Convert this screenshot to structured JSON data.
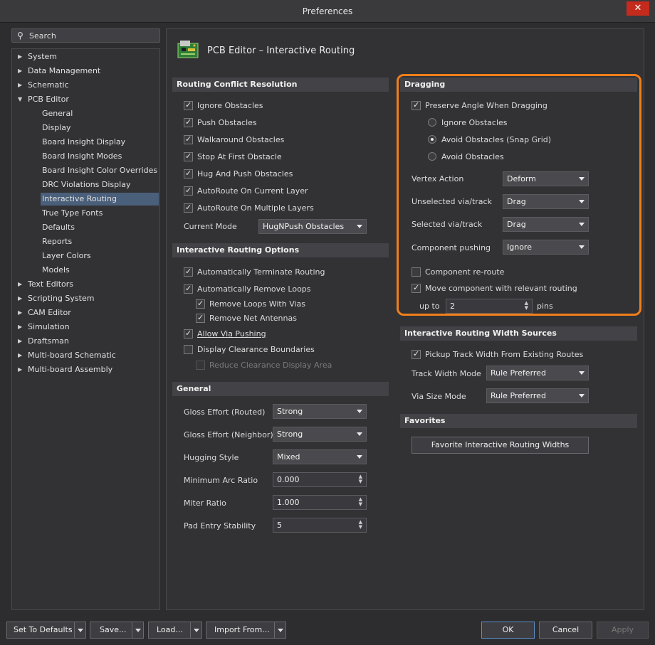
{
  "window": {
    "title": "Preferences",
    "close": "✕"
  },
  "search": {
    "placeholder": "Search"
  },
  "tree": [
    {
      "label": "System",
      "level": 0,
      "expandable": true
    },
    {
      "label": "Data Management",
      "level": 0,
      "expandable": true
    },
    {
      "label": "Schematic",
      "level": 0,
      "expandable": true
    },
    {
      "label": "PCB Editor",
      "level": 0,
      "expanded": true
    },
    {
      "label": "General",
      "level": 1
    },
    {
      "label": "Display",
      "level": 1
    },
    {
      "label": "Board Insight Display",
      "level": 1
    },
    {
      "label": "Board Insight Modes",
      "level": 1
    },
    {
      "label": "Board Insight Color Overrides",
      "level": 1
    },
    {
      "label": "DRC Violations Display",
      "level": 1
    },
    {
      "label": "Interactive Routing",
      "level": 1,
      "selected": true
    },
    {
      "label": "True Type Fonts",
      "level": 1
    },
    {
      "label": "Defaults",
      "level": 1
    },
    {
      "label": "Reports",
      "level": 1
    },
    {
      "label": "Layer Colors",
      "level": 1
    },
    {
      "label": "Models",
      "level": 1
    },
    {
      "label": "Text Editors",
      "level": 0,
      "expandable": true
    },
    {
      "label": "Scripting System",
      "level": 0,
      "expandable": true
    },
    {
      "label": "CAM Editor",
      "level": 0,
      "expandable": true
    },
    {
      "label": "Simulation",
      "level": 0,
      "expandable": true
    },
    {
      "label": "Draftsman",
      "level": 0,
      "expandable": true
    },
    {
      "label": "Multi-board Schematic",
      "level": 0,
      "expandable": true
    },
    {
      "label": "Multi-board Assembly",
      "level": 0,
      "expandable": true
    }
  ],
  "page": {
    "title": "PCB Editor – Interactive Routing"
  },
  "conflict": {
    "title": "Routing Conflict Resolution",
    "options": [
      {
        "label": "Ignore Obstacles",
        "checked": true
      },
      {
        "label": "Push Obstacles",
        "checked": true
      },
      {
        "label": "Walkaround Obstacles",
        "checked": true
      },
      {
        "label": "Stop At First Obstacle",
        "checked": true
      },
      {
        "label": "Hug And Push Obstacles",
        "checked": true
      },
      {
        "label": "AutoRoute On Current Layer",
        "checked": true
      },
      {
        "label": "AutoRoute On Multiple Layers",
        "checked": true
      }
    ],
    "mode_label": "Current Mode",
    "mode_value": "HugNPush Obstacles"
  },
  "iro": {
    "title": "Interactive Routing Options",
    "auto_terminate": "Automatically Terminate Routing",
    "auto_remove_loops": "Automatically Remove Loops",
    "remove_loops_vias": "Remove Loops With Vias",
    "remove_net_antennas": "Remove Net Antennas",
    "allow_via_pushing": "Allow Via Pushing",
    "display_clearance": "Display Clearance Boundaries",
    "reduce_clearance": "Reduce Clearance Display Area"
  },
  "general": {
    "title": "General",
    "gloss_routed_label": "Gloss Effort (Routed)",
    "gloss_routed": "Strong",
    "gloss_neighbor_label": "Gloss Effort (Neighbor)",
    "gloss_neighbor": "Strong",
    "hugging_label": "Hugging Style",
    "hugging": "Mixed",
    "min_arc_label": "Minimum Arc Ratio",
    "min_arc": "0.000",
    "miter_label": "Miter Ratio",
    "miter": "1.000",
    "pad_entry_label": "Pad Entry Stability",
    "pad_entry": "5"
  },
  "dragging": {
    "title": "Dragging",
    "preserve_angle": "Preserve Angle When Dragging",
    "ignore_obstacles": "Ignore Obstacles",
    "avoid_snap": "Avoid Obstacles (Snap Grid)",
    "avoid": "Avoid Obstacles",
    "vertex_label": "Vertex Action",
    "vertex": "Deform",
    "unselected_label": "Unselected via/track",
    "unselected": "Drag",
    "selected_label": "Selected via/track",
    "selected": "Drag",
    "pushing_label": "Component pushing",
    "pushing": "Ignore",
    "reroute": "Component re-route",
    "move_component": "Move component with relevant routing",
    "upto_label": "up to",
    "upto": "2",
    "pins_label": "pins"
  },
  "width_sources": {
    "title": "Interactive Routing Width Sources",
    "pickup": "Pickup Track Width From Existing Routes",
    "track_mode_label": "Track Width Mode",
    "track_mode": "Rule Preferred",
    "via_mode_label": "Via Size Mode",
    "via_mode": "Rule Preferred"
  },
  "favorites": {
    "title": "Favorites",
    "button": "Favorite Interactive Routing Widths"
  },
  "footer": {
    "set_defaults": "Set To Defaults",
    "save": "Save...",
    "load": "Load...",
    "import": "Import From...",
    "ok": "OK",
    "cancel": "Cancel",
    "apply": "Apply"
  },
  "colors": {
    "accent_highlight": "#f07f1a",
    "selection": "#4a5f7a"
  }
}
